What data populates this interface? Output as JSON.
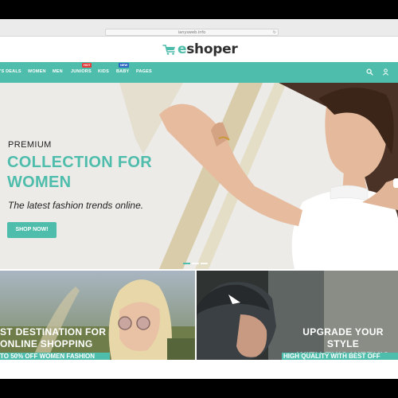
{
  "browser": {
    "url": "ianysweb.info",
    "reload_icon": "reload-icon"
  },
  "logo": {
    "icon": "shopping-cart-icon",
    "text_prefix": "e",
    "text_main": "shoper"
  },
  "nav": {
    "items": [
      {
        "label": "'S DEALS"
      },
      {
        "label": "WOMEN"
      },
      {
        "label": "MEN"
      },
      {
        "label": "JUNIORS",
        "badge": "HOT"
      },
      {
        "label": "KIDS"
      },
      {
        "label": "BABY",
        "badge": "NEW"
      },
      {
        "label": "PAGES"
      }
    ],
    "icons": [
      "search-icon",
      "user-icon"
    ]
  },
  "hero": {
    "pretitle": "PREMIUM",
    "title_line1": "COLLECTION FOR",
    "title_line2": "WOMEN",
    "subtitle": "The latest fashion trends online.",
    "cta": "SHOP NOW!",
    "slides_total": 3,
    "active_slide": 1
  },
  "banners": {
    "left": {
      "title_line1": "ST DESTINATION FOR",
      "title_line2": "ONLINE SHOPPING",
      "strip": "TO 50% OFF WOMEN FASHION"
    },
    "right": {
      "title_line1": "UPGRADE YOUR STYLE",
      "title_line2": "WITH THIS WEEK'S",
      "strip": "HIGH QUALITY WITH BEST OFF"
    }
  },
  "colors": {
    "accent": "#4fbdab",
    "hot": "#e23a3a",
    "new": "#2b66c4"
  }
}
